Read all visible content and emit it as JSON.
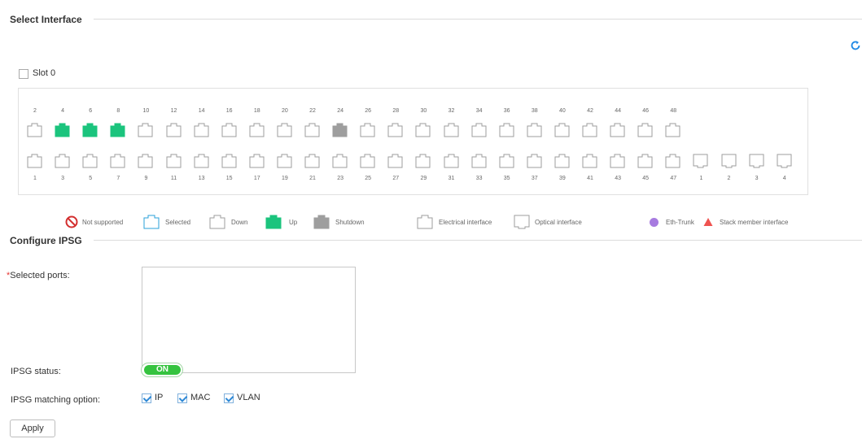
{
  "select_interface": {
    "title": "Select Interface",
    "slot_label": "Slot 0",
    "ports": {
      "top_numbers": [
        "2",
        "4",
        "6",
        "8",
        "10",
        "12",
        "14",
        "16",
        "18",
        "20",
        "22",
        "24",
        "26",
        "28",
        "30",
        "32",
        "34",
        "36",
        "38",
        "40",
        "42",
        "44",
        "46",
        "48"
      ],
      "top_states": [
        "down",
        "up",
        "up",
        "up",
        "down",
        "down",
        "down",
        "down",
        "down",
        "down",
        "down",
        "shutdown",
        "down",
        "down",
        "down",
        "down",
        "down",
        "down",
        "down",
        "down",
        "down",
        "down",
        "down",
        "down"
      ],
      "bottom_numbers": [
        "1",
        "3",
        "5",
        "7",
        "9",
        "11",
        "13",
        "15",
        "17",
        "19",
        "21",
        "23",
        "25",
        "27",
        "29",
        "31",
        "33",
        "35",
        "37",
        "39",
        "41",
        "43",
        "45",
        "47"
      ],
      "optical_numbers": [
        "1",
        "2",
        "3",
        "4"
      ]
    },
    "legend": {
      "not_supported": "Not supported",
      "selected": "Selected",
      "down": "Down",
      "up": "Up",
      "shutdown": "Shutdown",
      "electrical": "Electrical interface",
      "optical": "Optical interface",
      "eth_trunk": "Eth-Trunk",
      "stack_member": "Stack member interface"
    }
  },
  "configure_ipsg": {
    "title": "Configure IPSG",
    "selected_ports_label": "Selected ports:",
    "selected_ports_value": "",
    "status_label": "IPSG status:",
    "status_value": "ON",
    "matching_label": "IPSG matching option:",
    "options": [
      {
        "label": "IP",
        "checked": true
      },
      {
        "label": "MAC",
        "checked": true
      },
      {
        "label": "VLAN",
        "checked": true
      }
    ],
    "apply_label": "Apply"
  },
  "colors": {
    "up": "#1bc47d",
    "shutdown": "#9e9e9e",
    "selected_border": "#2aa0d8",
    "not_supported": "#d32f2f",
    "eth_trunk": "#a77be0",
    "stack_member": "#ef5350",
    "toggle_on": "#35c33f"
  }
}
